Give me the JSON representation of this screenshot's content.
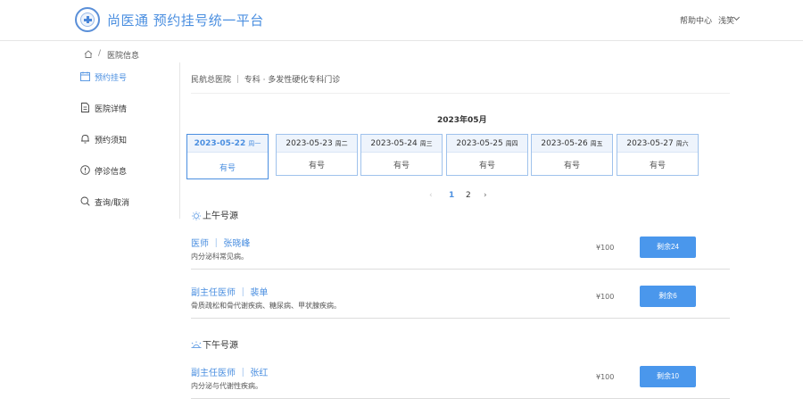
{
  "header": {
    "brand": "尚医通 预约挂号统一平台",
    "logo_text": "尚医通",
    "help": "帮助中心",
    "user": "浅笑"
  },
  "breadcrumb": {
    "separator": "/",
    "current": "医院信息"
  },
  "sidebar": {
    "items": [
      {
        "label": "预约挂号",
        "icon": "calendar-icon",
        "active": true
      },
      {
        "label": "医院详情",
        "icon": "document-icon",
        "active": false
      },
      {
        "label": "预约须知",
        "icon": "bell-icon",
        "active": false
      },
      {
        "label": "停诊信息",
        "icon": "info-circle-icon",
        "active": false
      },
      {
        "label": "查询/取消",
        "icon": "search-icon",
        "active": false
      }
    ]
  },
  "hospital_path": "民航总医院 ｜ 专科 · 多发性硬化专科门诊",
  "month": "2023年05月",
  "dates": [
    {
      "date": "2023-05-22",
      "weekday": "周一",
      "status": "有号",
      "active": true
    },
    {
      "date": "2023-05-23",
      "weekday": "周二",
      "status": "有号",
      "active": false
    },
    {
      "date": "2023-05-24",
      "weekday": "周三",
      "status": "有号",
      "active": false
    },
    {
      "date": "2023-05-25",
      "weekday": "周四",
      "status": "有号",
      "active": false
    },
    {
      "date": "2023-05-26",
      "weekday": "周五",
      "status": "有号",
      "active": false
    },
    {
      "date": "2023-05-27",
      "weekday": "周六",
      "status": "有号",
      "active": false
    }
  ],
  "pager": {
    "prev": "‹",
    "pages": [
      "1",
      "2"
    ],
    "current": "1",
    "next": "›"
  },
  "morning": {
    "title": "上午号源",
    "doctors": [
      {
        "title": "医师 ｜ 张晓峰",
        "desc": "内分泌科常见病。",
        "price": "¥100",
        "button": "剩余24"
      },
      {
        "title": "副主任医师 ｜ 裴单",
        "desc": "骨质疏松和骨代谢疾病、糖尿病、甲状腺疾病。",
        "price": "¥100",
        "button": "剩余6"
      }
    ]
  },
  "afternoon": {
    "title": "下午号源",
    "doctors": [
      {
        "title": "副主任医师 ｜ 张红",
        "desc": "内分泌与代谢性疾病。",
        "price": "¥100",
        "button": "剩余10"
      }
    ]
  },
  "colors": {
    "accent": "#4b8fe0",
    "button": "#4a97ec",
    "card_border": "#9fc2ec"
  }
}
